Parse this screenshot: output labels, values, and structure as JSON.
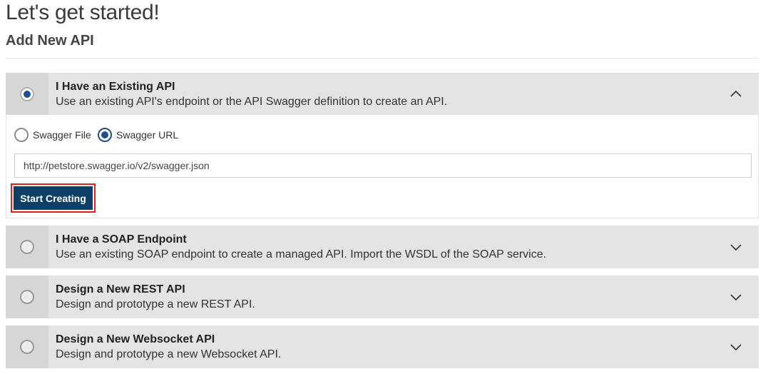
{
  "header": {
    "title": "Let's get started!",
    "subtitle": "Add New API"
  },
  "options": [
    {
      "title": "I Have an Existing API",
      "description": "Use an existing API's endpoint or the API Swagger definition to create an API.",
      "selected": true,
      "expanded": true,
      "chevron": "chevron-up-icon"
    },
    {
      "title": "I Have a SOAP Endpoint",
      "description": "Use an existing SOAP endpoint to create a managed API. Import the WSDL of the SOAP service.",
      "selected": false,
      "expanded": false,
      "chevron": "chevron-down-icon"
    },
    {
      "title": "Design a New REST API",
      "description": "Design and prototype a new REST API.",
      "selected": false,
      "expanded": false,
      "chevron": "chevron-down-icon"
    },
    {
      "title": "Design a New Websocket API",
      "description": "Design and prototype a new Websocket API.",
      "selected": false,
      "expanded": false,
      "chevron": "chevron-down-icon"
    }
  ],
  "existing_api_form": {
    "source_options": [
      {
        "label": "Swagger File",
        "selected": false
      },
      {
        "label": "Swagger URL",
        "selected": true
      }
    ],
    "url_value": "http://petstore.swagger.io/v2/swagger.json",
    "submit_label": "Start Creating"
  },
  "colors": {
    "primary_button": "#0e3f66",
    "highlight_border": "#e0201b",
    "radio_selected": "#1d4f91",
    "panel_bg": "#e4e4e4"
  }
}
